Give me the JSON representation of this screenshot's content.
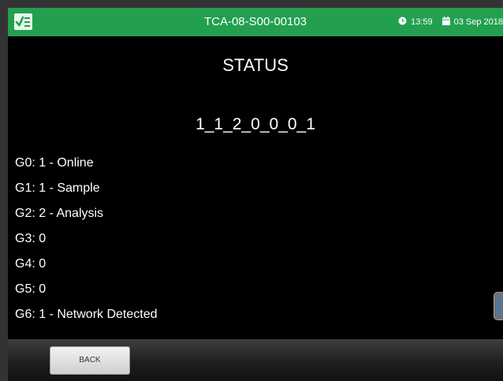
{
  "header": {
    "device_id": "TCA-08-S00-00103",
    "time": "13:59",
    "date": "03 Sep 2018",
    "app_icon": "checklist-icon",
    "time_icon": "clock-icon",
    "date_icon": "calendar-icon",
    "color": "#22a050"
  },
  "main": {
    "title": "STATUS",
    "code": "1_1_2_0_0_0_1",
    "items": [
      "G0: 1 - Online",
      "G1: 1 - Sample",
      "G2: 2 - Analysis",
      "G3: 0",
      "G4: 0",
      "G5: 0",
      "G6: 1 - Network Detected"
    ]
  },
  "footer": {
    "back_label": "BACK"
  }
}
